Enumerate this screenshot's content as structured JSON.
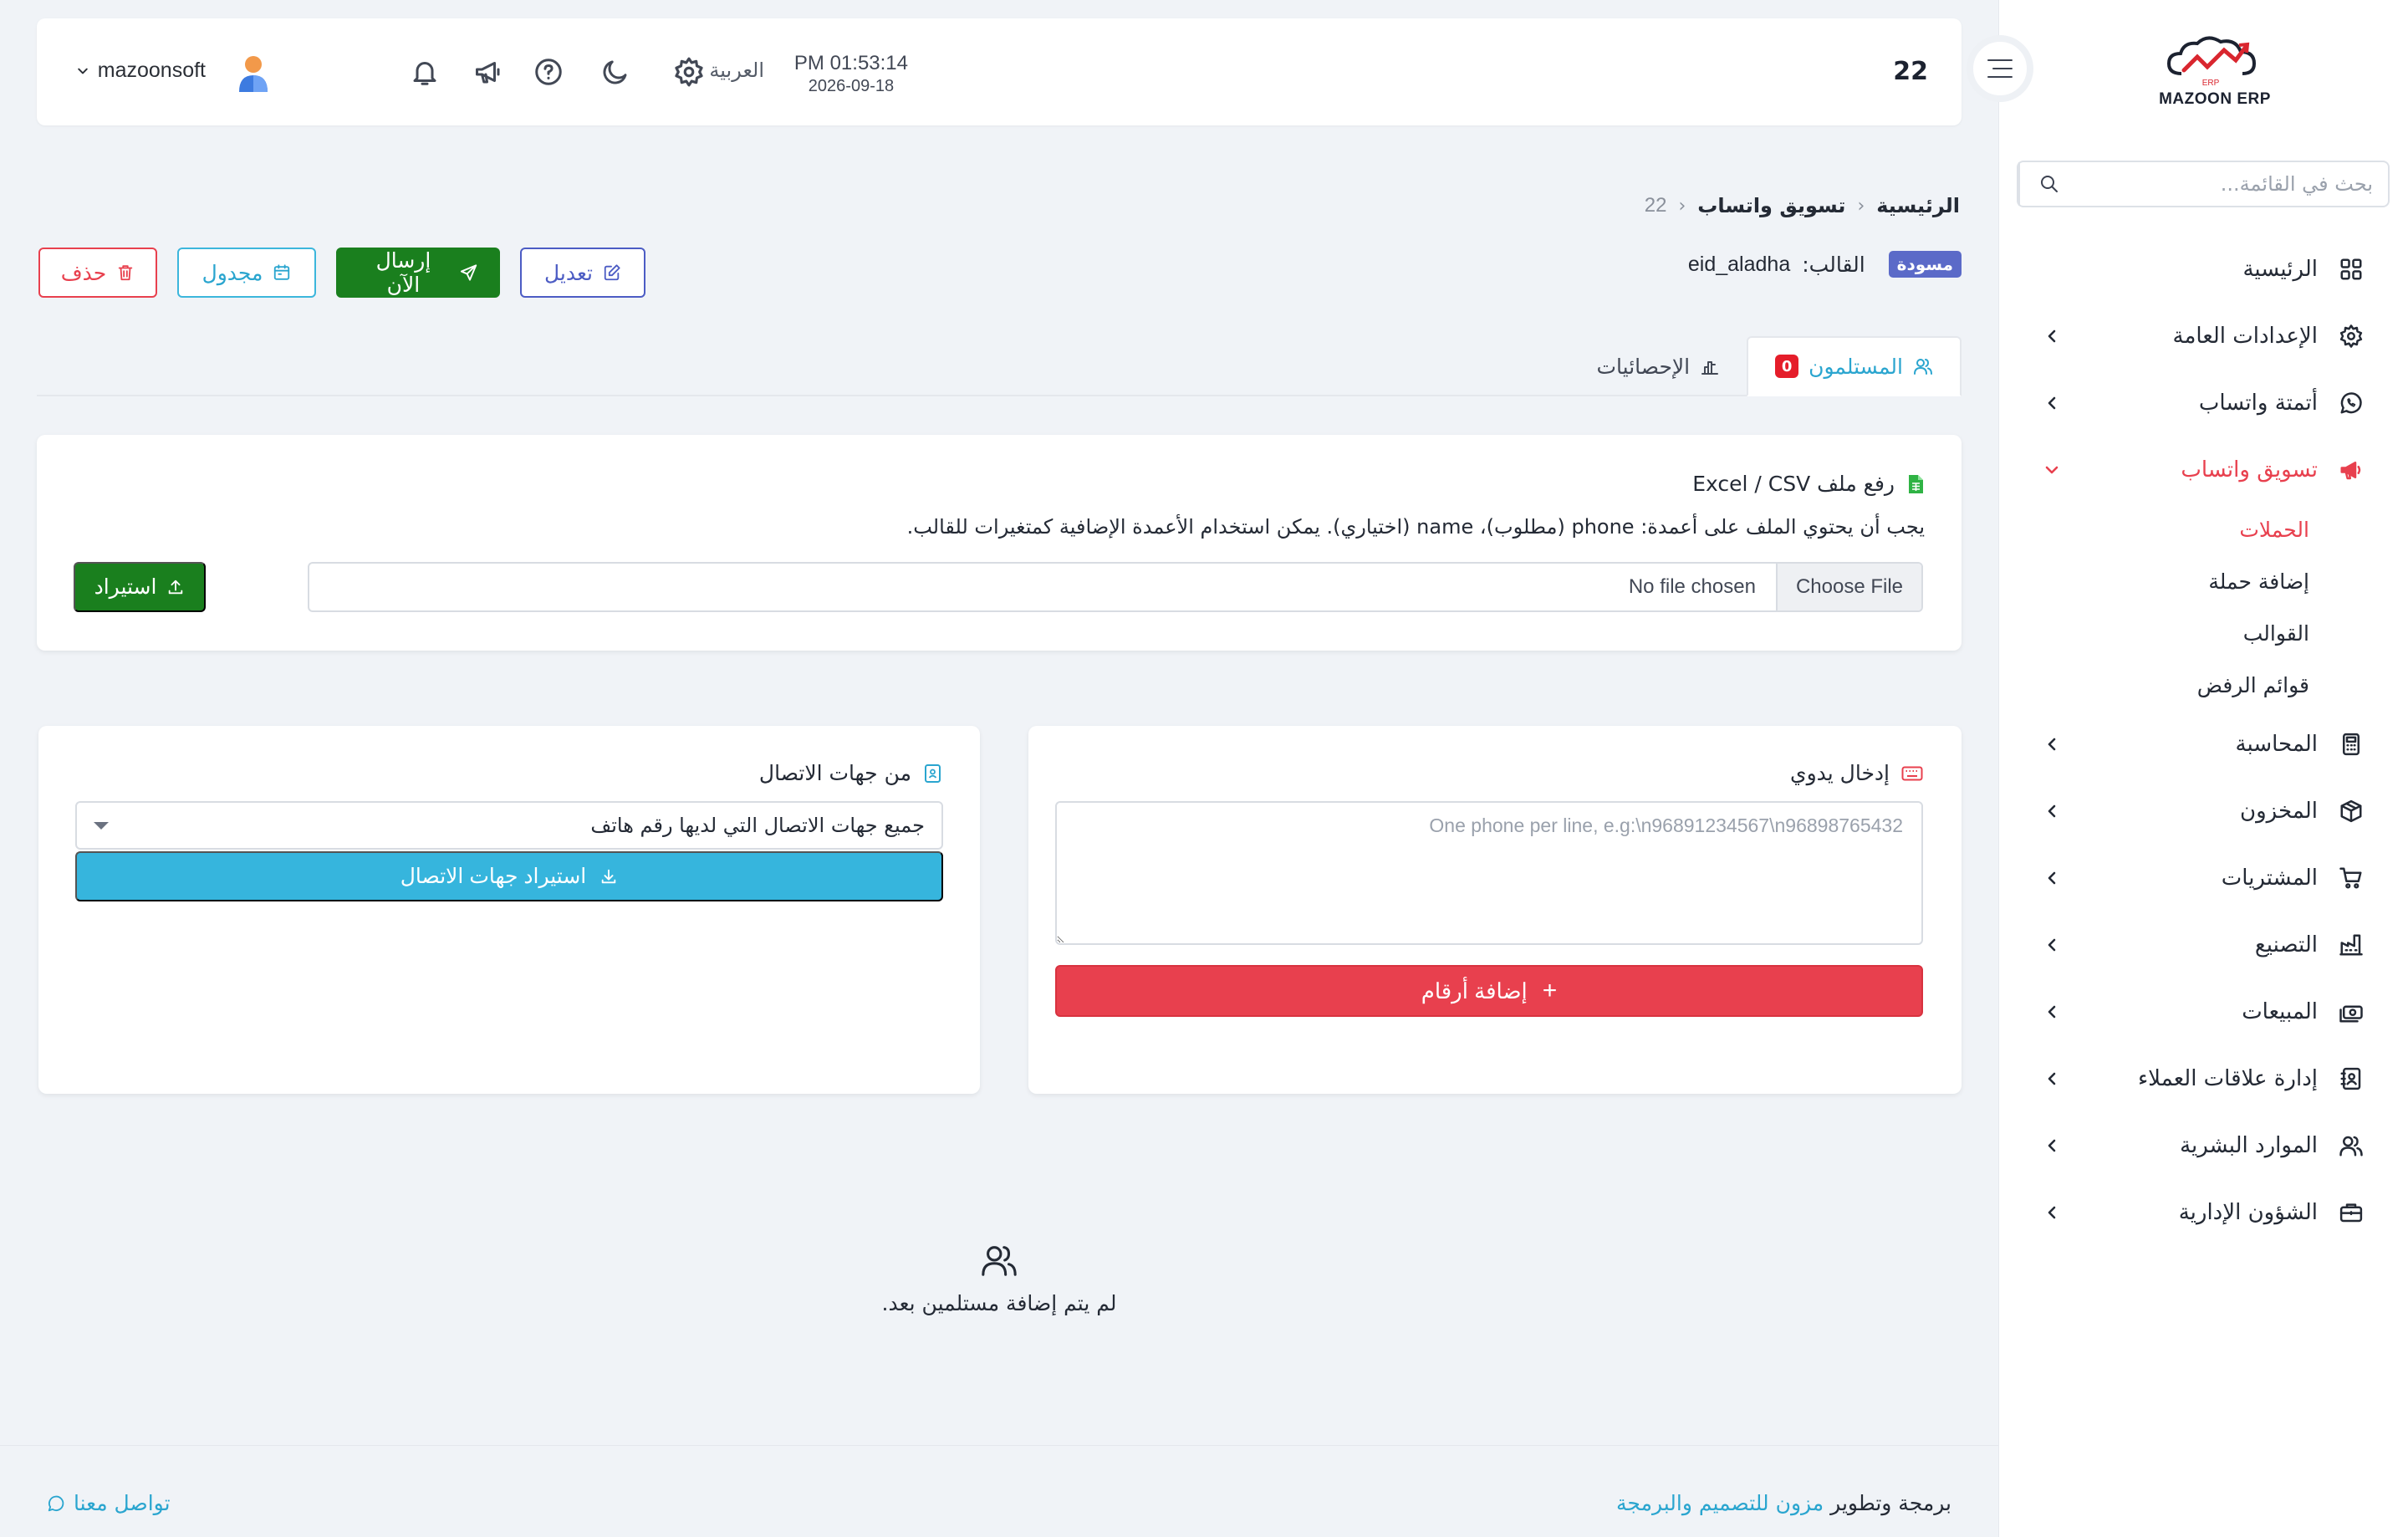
{
  "sidebar": {
    "logo_text": "MAZOON ERP",
    "search_placeholder": "بحث في القائمة...",
    "menu": [
      {
        "label": "الرئيسية",
        "icon": "grid-icon",
        "has_children": false
      },
      {
        "label": "الإعدادات العامة",
        "icon": "gear-icon",
        "has_children": true
      },
      {
        "label": "أتمتة واتساب",
        "icon": "whatsapp-icon",
        "has_children": true
      },
      {
        "label": "تسويق واتساب",
        "icon": "megaphone-icon",
        "has_children": true,
        "active": true,
        "expanded": true
      },
      {
        "label": "المحاسبة",
        "icon": "calculator-icon",
        "has_children": true
      },
      {
        "label": "المخزون",
        "icon": "box-icon",
        "has_children": true
      },
      {
        "label": "المشتريات",
        "icon": "cart-icon",
        "has_children": true
      },
      {
        "label": "التصنيع",
        "icon": "factory-icon",
        "has_children": true
      },
      {
        "label": "المبيعات",
        "icon": "cash-icon",
        "has_children": true
      },
      {
        "label": "إدارة علاقات العملاء",
        "icon": "contacts-book-icon",
        "has_children": true
      },
      {
        "label": "الموارد البشرية",
        "icon": "users-icon",
        "has_children": true
      },
      {
        "label": "الشؤون الإدارية",
        "icon": "briefcase-icon",
        "has_children": true
      }
    ],
    "submenu": [
      {
        "label": "الحملات",
        "active": true
      },
      {
        "label": "إضافة حملة"
      },
      {
        "label": "القوالب"
      },
      {
        "label": "قوائم الرفض"
      }
    ]
  },
  "header": {
    "page_id": "22",
    "time": "PM 01:53:14",
    "date": "2026-09-18",
    "language": "العربية",
    "username": "mazoonsoft"
  },
  "breadcrumb": {
    "home": "الرئيسية",
    "section": "تسويق واتساب",
    "current": "22"
  },
  "campaign": {
    "status_badge": "مسودة",
    "template_label": "القالب:",
    "template_value": "eid_aladha"
  },
  "actions": {
    "edit": "تعديل",
    "send_now": "إرسال الآن",
    "scheduled": "مجدول",
    "delete": "حذف"
  },
  "tabs": {
    "recipients": "المستلمون",
    "recipients_count": "0",
    "statistics": "الإحصائيات"
  },
  "upload": {
    "title": "رفع ملف Excel / CSV",
    "hint": "يجب أن يحتوي الملف على أعمدة: phone (مطلوب)، name (اختياري). يمكن استخدام الأعمدة الإضافية كمتغيرات للقالب.",
    "choose_file": "Choose File",
    "no_file": "No file chosen",
    "import_button": "استيراد"
  },
  "manual": {
    "title": "إدخال يدوي",
    "placeholder": "One phone per line, e.g:\\n96891234567\\n96898765432",
    "add_button": "إضافة أرقام"
  },
  "contacts": {
    "title": "من جهات الاتصال",
    "selected_option": "جميع جهات الاتصال التي لديها رقم هاتف",
    "import_button": "استيراد جهات الاتصال"
  },
  "empty_state": {
    "message": "لم يتم إضافة مستلمين بعد."
  },
  "footer": {
    "credit_prefix": "برمجة وتطوير",
    "credit_link": "مزون للتصميم والبرمجة",
    "contact": "تواصل معنا"
  },
  "colors": {
    "accent_red": "#e8404e",
    "accent_blue": "#2aa5cf",
    "green": "#1a7f1e",
    "draft_badge": "#5b6ac8"
  }
}
